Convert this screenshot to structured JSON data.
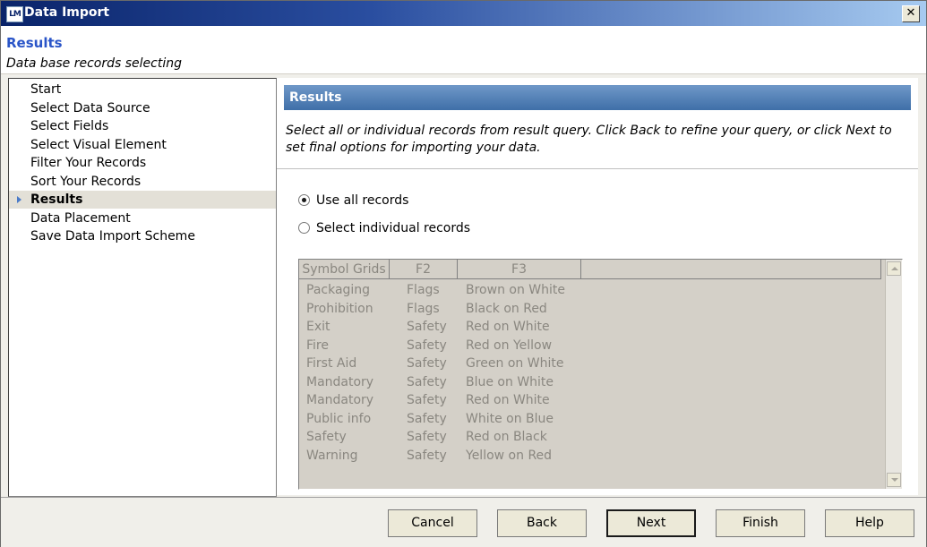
{
  "window": {
    "title": "Data Import",
    "icon_text": "LM"
  },
  "header": {
    "title": "Results",
    "subtitle": "Data base records selecting"
  },
  "sidebar": {
    "steps": [
      "Start",
      "Select Data Source",
      "Select Fields",
      "Select Visual Element",
      "Filter Your Records",
      "Sort Your Records",
      "Results",
      "Data Placement",
      "Save Data Import Scheme"
    ],
    "active_step": "Results"
  },
  "main": {
    "banner": "Results",
    "instructions": "Select all or individual records from result query. Click Back to refine your query, or click Next to set final options for importing your data.",
    "options": [
      {
        "label": "Use all records",
        "checked": true
      },
      {
        "label": "Select individual records",
        "checked": false
      }
    ],
    "grid": {
      "columns": [
        "Symbol Grids",
        "F2",
        "F3"
      ],
      "rows": [
        [
          "Packaging",
          "Flags",
          "Brown on White"
        ],
        [
          "Prohibition",
          "Flags",
          "Black on Red"
        ],
        [
          "Exit",
          "Safety",
          "Red on White"
        ],
        [
          "Fire",
          "Safety",
          "Red on Yellow"
        ],
        [
          "First Aid",
          "Safety",
          "Green on White"
        ],
        [
          "Mandatory",
          "Safety",
          "Blue on White"
        ],
        [
          "Mandatory",
          "Safety",
          "Red on White"
        ],
        [
          "Public info",
          "Safety",
          "White on Blue"
        ],
        [
          "Safety",
          "Safety",
          "Red on Black"
        ],
        [
          "Warning",
          "Safety",
          "Yellow on Red"
        ]
      ]
    }
  },
  "buttons": {
    "cancel": "Cancel",
    "back": "Back",
    "next": "Next",
    "finish": "Finish",
    "help": "Help"
  },
  "colors": {
    "title_bar_start": "#0a246a",
    "title_bar_end": "#a6caf0",
    "header_title": "#2a55c8",
    "banner": "#4f7fb8",
    "active_step_bg": "#e3e0d7"
  }
}
